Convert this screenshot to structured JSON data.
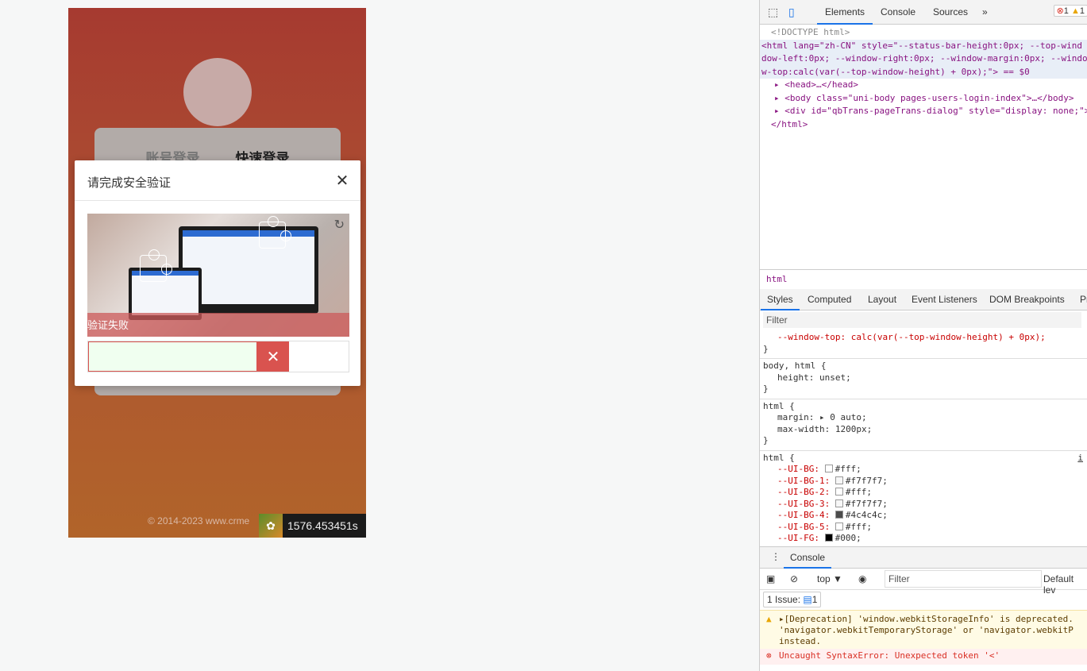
{
  "phone": {
    "tabs": [
      "账号登录",
      "快速登录"
    ],
    "footer": "© 2014-2023 www.crme",
    "timer": "1576.453451s"
  },
  "dialog": {
    "title": "请完成安全验证",
    "fail_text": "验证失败"
  },
  "devtools": {
    "tabs": [
      "Elements",
      "Console",
      "Sources"
    ],
    "errors": "1",
    "warnings": "1",
    "dom": {
      "doctype": "<!DOCTYPE html>",
      "html_open_1": "<html lang=\"zh-CN\" style=\"--status-bar-height:0px; --top-wind",
      "html_open_2": "dow-left:0px; --window-right:0px; --window-margin:0px; --windo",
      "html_open_3": "w-top:calc(var(--top-window-height) + 0px);\"> == $0",
      "head": "<head>…</head>",
      "body": "<body class=\"uni-body pages-users-login-index\">…</body>",
      "div": "<div id=\"qbTrans-pageTrans-dialog\" style=\"display: none;\">…",
      "html_close": "</html>"
    },
    "breadcrumb": "html",
    "style_tabs": [
      "Styles",
      "Computed",
      "Layout",
      "Event Listeners",
      "DOM Breakpoints",
      "Pr"
    ],
    "filter_placeholder": "Filter",
    "rules": {
      "r1_prop": "--window-top: calc(var(--top-window-height) + 0px);",
      "r2_selector": "body, html {",
      "r2_prop": "height: unset;",
      "r3_selector": "html {",
      "r3_prop1": "margin: ▸ 0 auto;",
      "r3_prop2": "max-width: 1200px;",
      "r4_selector": "html {",
      "r4_link": "i",
      "vars": [
        {
          "name": "--UI-BG:",
          "value": "#fff;",
          "color": "#ffffff"
        },
        {
          "name": "--UI-BG-1:",
          "value": "#f7f7f7;",
          "color": "#f7f7f7"
        },
        {
          "name": "--UI-BG-2:",
          "value": "#fff;",
          "color": "#ffffff"
        },
        {
          "name": "--UI-BG-3:",
          "value": "#f7f7f7;",
          "color": "#f7f7f7"
        },
        {
          "name": "--UI-BG-4:",
          "value": "#4c4c4c;",
          "color": "#4c4c4c"
        },
        {
          "name": "--UI-BG-5:",
          "value": "#fff;",
          "color": "#ffffff"
        },
        {
          "name": "--UI-FG:",
          "value": "#000;",
          "color": "#000000"
        }
      ]
    },
    "console": {
      "tab": "Console",
      "context": "top ▼",
      "filter": "Filter",
      "level": "Default lev",
      "issues": "1 Issue:",
      "issues_count": "1",
      "warn_1": "▸[Deprecation] 'window.webkitStorageInfo' is deprecated.",
      "warn_2": "'navigator.webkitTemporaryStorage' or 'navigator.webkitP",
      "warn_3": "instead.",
      "error": "Uncaught SyntaxError: Unexpected token '<'"
    }
  }
}
